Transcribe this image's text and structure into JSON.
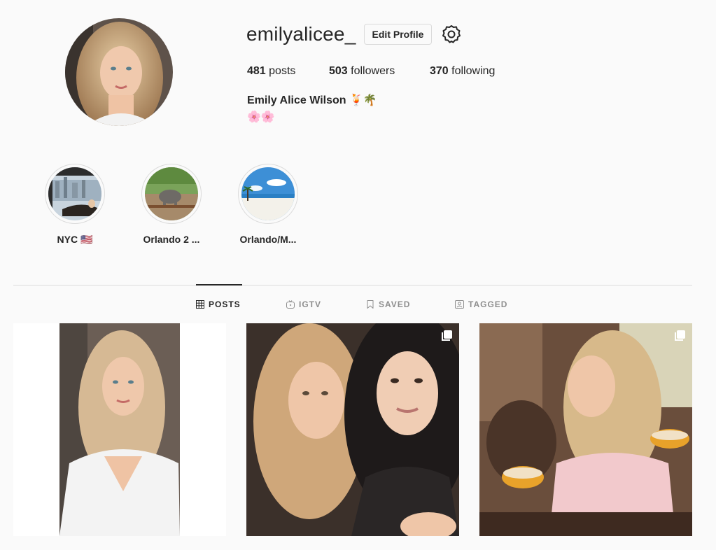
{
  "profile": {
    "username": "emilyalicee_",
    "edit_profile_label": "Edit Profile",
    "settings_icon": "gear-icon",
    "stats": {
      "posts_count": "481",
      "posts_label": "posts",
      "followers_count": "503",
      "followers_label": "followers",
      "following_count": "370",
      "following_label": "following"
    },
    "full_name": "Emily Alice Wilson",
    "name_emoji": "🍹🌴",
    "bio": "🌸🌸"
  },
  "highlights": [
    {
      "label": "NYC 🇺🇸"
    },
    {
      "label": "Orlando 2 ..."
    },
    {
      "label": "Orlando/M..."
    }
  ],
  "tabs": [
    {
      "label": "POSTS",
      "icon": "grid-icon",
      "active": true
    },
    {
      "label": "IGTV",
      "icon": "igtv-icon",
      "active": false
    },
    {
      "label": "SAVED",
      "icon": "bookmark-icon",
      "active": false
    },
    {
      "label": "TAGGED",
      "icon": "tagged-icon",
      "active": false
    }
  ],
  "posts": [
    {
      "multiple": false
    },
    {
      "multiple": true,
      "icon": "multiple-images-icon"
    },
    {
      "multiple": true,
      "icon": "multiple-images-icon"
    }
  ],
  "colors": {
    "background": "#fafafa",
    "text": "#262626",
    "muted": "#8e8e8e",
    "border": "#dbdbdb"
  }
}
